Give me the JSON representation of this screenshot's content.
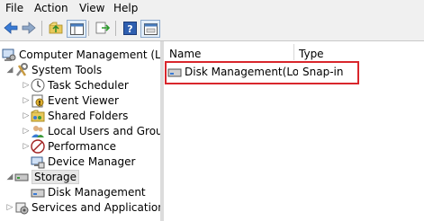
{
  "menu": [
    "File",
    "Action",
    "View",
    "Help"
  ],
  "toolbar": {
    "icons": [
      "back-arrow-icon",
      "forward-arrow-icon",
      "up-folder-icon",
      "show-hide-tree-icon",
      "export-list-icon",
      "help-icon",
      "properties-icon"
    ]
  },
  "tree": {
    "root": "Computer Management (Local",
    "system_tools": "System Tools",
    "task_scheduler": "Task Scheduler",
    "event_viewer": "Event Viewer",
    "shared_folders": "Shared Folders",
    "local_users": "Local Users and Groups",
    "performance": "Performance",
    "device_manager": "Device Manager",
    "storage": "Storage",
    "disk_management": "Disk Management",
    "services": "Services and Applications"
  },
  "list": {
    "headers": {
      "name": "Name",
      "type": "Type"
    },
    "rows": [
      {
        "name": "Disk Management(Lo...",
        "type": "Snap-in"
      }
    ]
  }
}
